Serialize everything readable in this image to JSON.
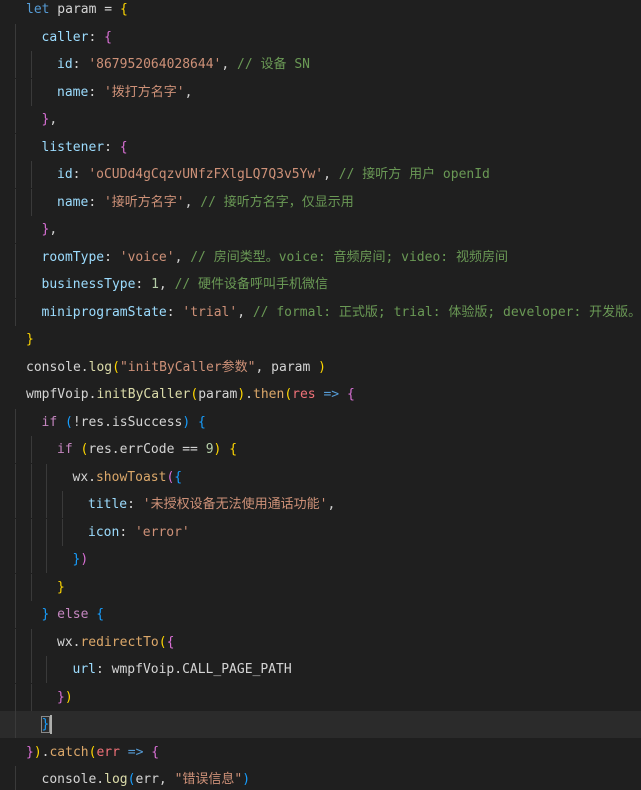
{
  "editor": {
    "lines": [
      {
        "indent": 0,
        "tokens": [
          [
            "decl",
            "let"
          ],
          [
            "plain",
            " param = "
          ],
          [
            "bracket1",
            "{"
          ]
        ]
      },
      {
        "indent": 1,
        "tokens": [
          [
            "prop",
            "caller"
          ],
          [
            "plain",
            ": "
          ],
          [
            "bracket2",
            "{"
          ]
        ]
      },
      {
        "indent": 2,
        "tokens": [
          [
            "prop",
            "id"
          ],
          [
            "plain",
            ": "
          ],
          [
            "str",
            "'867952064028644'"
          ],
          [
            "plain",
            ", "
          ],
          [
            "comment",
            "// 设备 SN"
          ]
        ]
      },
      {
        "indent": 2,
        "tokens": [
          [
            "prop",
            "name"
          ],
          [
            "plain",
            ": "
          ],
          [
            "str",
            "'拨打方名字'"
          ],
          [
            "plain",
            ","
          ]
        ]
      },
      {
        "indent": 1,
        "tokens": [
          [
            "bracket2",
            "}"
          ],
          [
            "plain",
            ","
          ]
        ]
      },
      {
        "indent": 1,
        "tokens": [
          [
            "prop",
            "listener"
          ],
          [
            "plain",
            ": "
          ],
          [
            "bracket2",
            "{"
          ]
        ]
      },
      {
        "indent": 2,
        "tokens": [
          [
            "prop",
            "id"
          ],
          [
            "plain",
            ": "
          ],
          [
            "str",
            "'oCUDd4gCqzvUNfzFXlgLQ7Q3v5Yw'"
          ],
          [
            "plain",
            ", "
          ],
          [
            "comment",
            "// 接听方 用户 openId"
          ]
        ]
      },
      {
        "indent": 2,
        "tokens": [
          [
            "prop",
            "name"
          ],
          [
            "plain",
            ": "
          ],
          [
            "str",
            "'接听方名字'"
          ],
          [
            "plain",
            ", "
          ],
          [
            "comment",
            "// 接听方名字，仅显示用"
          ]
        ]
      },
      {
        "indent": 1,
        "tokens": [
          [
            "bracket2",
            "}"
          ],
          [
            "plain",
            ","
          ]
        ]
      },
      {
        "indent": 1,
        "tokens": [
          [
            "prop",
            "roomType"
          ],
          [
            "plain",
            ": "
          ],
          [
            "str",
            "'voice'"
          ],
          [
            "plain",
            ", "
          ],
          [
            "comment",
            "// 房间类型。voice: 音频房间; video: 视频房间"
          ]
        ]
      },
      {
        "indent": 1,
        "tokens": [
          [
            "prop",
            "businessType"
          ],
          [
            "plain",
            ": "
          ],
          [
            "num",
            "1"
          ],
          [
            "plain",
            ", "
          ],
          [
            "comment",
            "// 硬件设备呼叫手机微信"
          ]
        ]
      },
      {
        "indent": 1,
        "tokens": [
          [
            "prop",
            "miniprogramState"
          ],
          [
            "plain",
            ": "
          ],
          [
            "str",
            "'trial'"
          ],
          [
            "plain",
            ", "
          ],
          [
            "comment",
            "// formal: 正式版; trial: 体验版; developer: 开发版。"
          ]
        ]
      },
      {
        "indent": 0,
        "tokens": [
          [
            "bracket1",
            "}"
          ]
        ]
      },
      {
        "indent": 0,
        "tokens": [
          [
            "plain",
            "console."
          ],
          [
            "fn",
            "log"
          ],
          [
            "bracket1",
            "("
          ],
          [
            "str",
            "\"initByCaller参数\""
          ],
          [
            "plain",
            ", param "
          ],
          [
            "bracket1",
            ")"
          ]
        ]
      },
      {
        "indent": 0,
        "tokens": [
          [
            "plain",
            "wmpfVoip."
          ],
          [
            "fn",
            "initByCaller"
          ],
          [
            "bracket1",
            "("
          ],
          [
            "plain",
            "param"
          ],
          [
            "bracket1",
            ")"
          ],
          [
            "plain",
            "."
          ],
          [
            "fn2",
            "then"
          ],
          [
            "bracket1",
            "("
          ],
          [
            "param",
            "res"
          ],
          [
            "plain",
            " "
          ],
          [
            "decl",
            "=>"
          ],
          [
            "plain",
            " "
          ],
          [
            "bracket2",
            "{"
          ]
        ]
      },
      {
        "indent": 1,
        "tokens": [
          [
            "kw",
            "if"
          ],
          [
            "plain",
            " "
          ],
          [
            "bracket3",
            "("
          ],
          [
            "plain",
            "!res.isSuccess"
          ],
          [
            "bracket3",
            ")"
          ],
          [
            "plain",
            " "
          ],
          [
            "bracket3",
            "{"
          ]
        ]
      },
      {
        "indent": 2,
        "tokens": [
          [
            "kw",
            "if"
          ],
          [
            "plain",
            " "
          ],
          [
            "bracket1",
            "("
          ],
          [
            "plain",
            "res.errCode "
          ],
          [
            "plain",
            "=="
          ],
          [
            "plain",
            " "
          ],
          [
            "num",
            "9"
          ],
          [
            "bracket1",
            ")"
          ],
          [
            "plain",
            " "
          ],
          [
            "bracket1",
            "{"
          ]
        ]
      },
      {
        "indent": 3,
        "tokens": [
          [
            "plain",
            "wx."
          ],
          [
            "fn2",
            "showToast"
          ],
          [
            "bracket2",
            "("
          ],
          [
            "bracket3",
            "{"
          ]
        ]
      },
      {
        "indent": 4,
        "tokens": [
          [
            "prop",
            "title"
          ],
          [
            "plain",
            ": "
          ],
          [
            "str",
            "'未授权设备无法使用通话功能'"
          ],
          [
            "plain",
            ","
          ]
        ]
      },
      {
        "indent": 4,
        "tokens": [
          [
            "prop",
            "icon"
          ],
          [
            "plain",
            ": "
          ],
          [
            "str",
            "'error'"
          ]
        ]
      },
      {
        "indent": 3,
        "tokens": [
          [
            "bracket3",
            "}"
          ],
          [
            "bracket2",
            ")"
          ]
        ]
      },
      {
        "indent": 2,
        "tokens": [
          [
            "bracket1",
            "}"
          ]
        ]
      },
      {
        "indent": 1,
        "tokens": [
          [
            "bracket3",
            "}"
          ],
          [
            "plain",
            " "
          ],
          [
            "kw",
            "else"
          ],
          [
            "plain",
            " "
          ],
          [
            "bracket3",
            "{"
          ]
        ]
      },
      {
        "indent": 2,
        "tokens": [
          [
            "plain",
            "wx."
          ],
          [
            "fn2",
            "redirectTo"
          ],
          [
            "bracket1",
            "("
          ],
          [
            "bracket2",
            "{"
          ]
        ]
      },
      {
        "indent": 3,
        "tokens": [
          [
            "prop",
            "url"
          ],
          [
            "plain",
            ": wmpfVoip.CALL_PAGE_PATH"
          ]
        ]
      },
      {
        "indent": 2,
        "tokens": [
          [
            "bracket2",
            "}"
          ],
          [
            "bracket1",
            ")"
          ]
        ]
      },
      {
        "indent": 1,
        "tokens": [
          [
            "bracket3",
            "}"
          ]
        ],
        "current": true
      },
      {
        "indent": 0,
        "tokens": [
          [
            "bracket2",
            "}"
          ],
          [
            "bracket1",
            ")"
          ],
          [
            "plain",
            "."
          ],
          [
            "fn2",
            "catch"
          ],
          [
            "bracket1",
            "("
          ],
          [
            "param",
            "err"
          ],
          [
            "plain",
            " "
          ],
          [
            "decl",
            "=>"
          ],
          [
            "plain",
            " "
          ],
          [
            "bracket2",
            "{"
          ]
        ]
      },
      {
        "indent": 1,
        "tokens": [
          [
            "plain",
            "console."
          ],
          [
            "fn",
            "log"
          ],
          [
            "bracket3",
            "("
          ],
          [
            "plain",
            "err, "
          ],
          [
            "str",
            "\"错误信息\""
          ],
          [
            "bracket3",
            ")"
          ]
        ]
      }
    ]
  }
}
